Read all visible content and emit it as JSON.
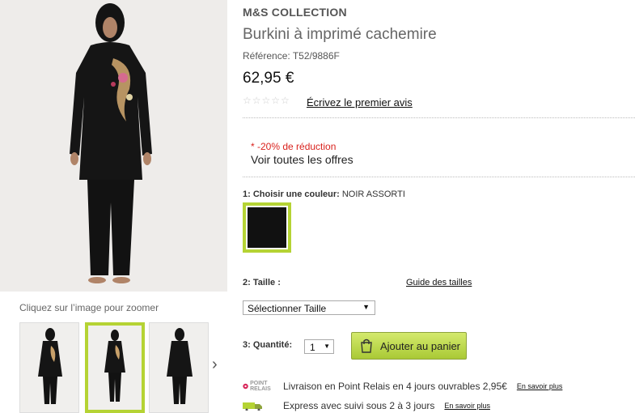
{
  "gallery": {
    "zoom_hint": "Cliquez sur l’image pour zoomer",
    "thumb_count": 3,
    "selected_thumb": 2
  },
  "product": {
    "brand": "M&S COLLECTION",
    "title": "Burkini à imprimé cachemire",
    "reference": "Référence: T52/9886F",
    "price": "62,95 €",
    "rating_stars": 0,
    "review_link": "Écrivez le premier avis"
  },
  "promo": {
    "discount": "* -20% de réduction",
    "offers_link": "Voir toutes les offres"
  },
  "color": {
    "label": "1: Choisir une couleur:",
    "value": "NOIR ASSORTI",
    "swatch_color": "#111111"
  },
  "size": {
    "label": "2: Taille :",
    "guide_link": "Guide des tailles",
    "select_value": "Sélectionner Taille"
  },
  "quantity": {
    "label": "3: Quantité:",
    "value": "1"
  },
  "cart": {
    "button_label": "Ajouter au panier",
    "accent_color": "#b5d334"
  },
  "shipping": [
    {
      "logo": "POINT RELAIS",
      "text": "Livraison en Point Relais en 4 jours ouvrables 2,95€",
      "more": "En savoir plus"
    },
    {
      "logo": "",
      "text": "Express avec suivi sous 2 à 3 jours",
      "more": "En savoir plus"
    }
  ]
}
